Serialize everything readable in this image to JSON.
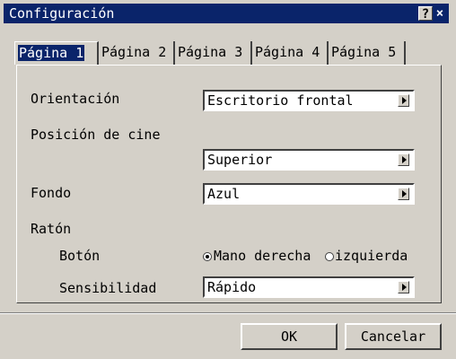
{
  "window": {
    "title": "Configuración",
    "help": "?",
    "close": "×"
  },
  "tabs": [
    "Página 1",
    "Página 2",
    "Página 3",
    "Página 4",
    "Página 5"
  ],
  "fields": {
    "orientacion": {
      "label": "Orientación",
      "value": "Escritorio frontal"
    },
    "posicion": {
      "label": "Posición de cine",
      "value": "Superior"
    },
    "fondo": {
      "label": "Fondo",
      "value": "Azul"
    },
    "raton": {
      "label": "Ratón"
    },
    "boton": {
      "label": "Botón",
      "opt1": "Mano derecha",
      "opt2": "izquierda"
    },
    "sensibilidad": {
      "label": "Sensibilidad",
      "value": "Rápido"
    }
  },
  "buttons": {
    "ok": "OK",
    "cancel": "Cancelar"
  }
}
